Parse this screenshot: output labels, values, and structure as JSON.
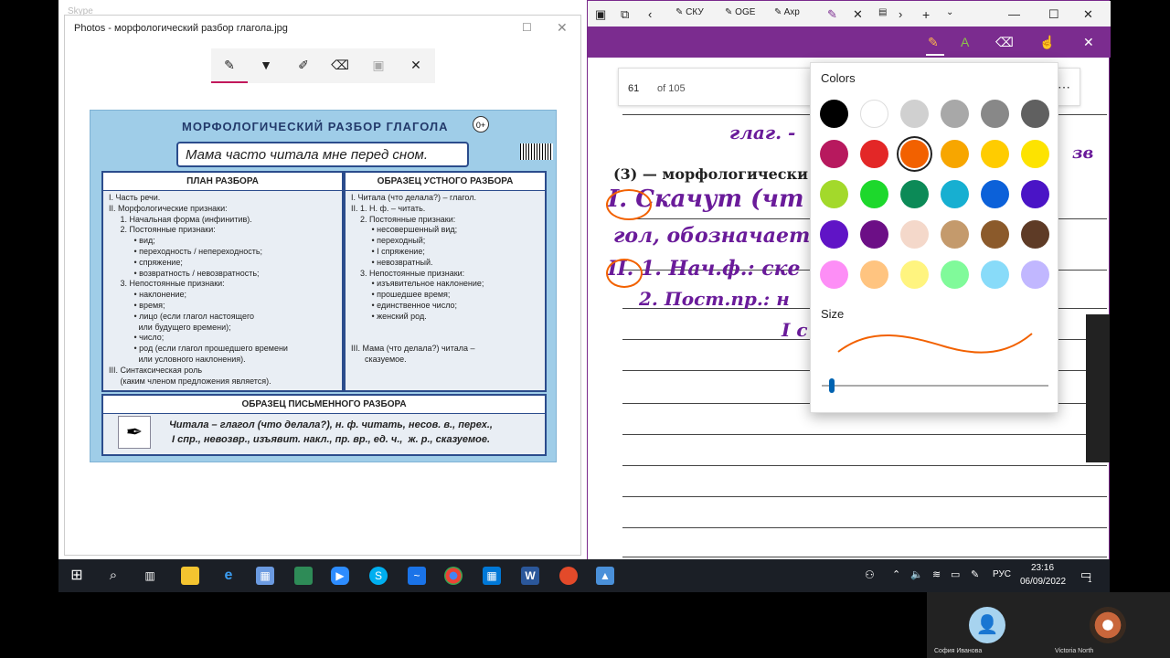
{
  "skype_title": "Skype",
  "photos": {
    "title": "Photos - морфологический разбор глагола.jpg",
    "tools": [
      "ballpoint-pen",
      "calligraphy-pen",
      "pencil",
      "eraser",
      "crop",
      "close"
    ]
  },
  "poster": {
    "heading": "МОРФОЛОГИЧЕСКИЙ РАЗБОР ГЛАГОЛА",
    "age": "0+",
    "sentence": "Мама часто читала мне перед сном.",
    "plan_title": "ПЛАН РАЗБОРА",
    "plan_lines": "I. Часть речи.\nII. Морфологические признаки:\n     1. Начальная форма (инфинитив).\n     2. Постоянные признаки:\n           • вид;\n           • переходность / непереходность;\n           • спряжение;\n           • возвратность / невозвратность;\n     3. Непостоянные признаки:\n           • наклонение;\n           • время;\n           • лицо (если глагол настоящего\n             или будущего времени);\n           • число;\n           • род (если глагол прошедшего времени\n             или условного наклонения).\nIII. Синтаксическая роль\n     (каким членом предложения является).",
    "sample_title": "ОБРАЗЕЦ УСТНОГО РАЗБОРА",
    "sample_lines": "I. Читала (что делала?) – глагол.\nII. 1. Н. ф. – читать.\n    2. Постоянные признаки:\n         • несовершенный вид;\n         • переходный;\n         • I спряжение;\n         • невозвратный.\n    3. Непостоянные признаки:\n         • изъявительное наклонение;\n         • прошедшее время;\n         • единственное число;\n         • женский род.\n\n\nIII. Мама (что делала?) читала –\n      сказуемое.",
    "written_title": "ОБРАЗЕЦ ПИСЬМЕННОГО РАЗБОРА",
    "written_text": "Читала – глагол (что делала?), н. ф. читать, несов. в., перех.,\n I спр., невозвр., изъявит. накл., пр. вр., ед. ч.,  ж. р., сказуемое."
  },
  "onenote": {
    "tabs": [
      "СКУ",
      "OGЕ",
      "Axp"
    ],
    "page_number": "61",
    "page_of": "of 105",
    "typed": "(3) — морфологически",
    "handwriting": [
      "глаг. -",
      "I. Скачут (чт",
      "гол, обозначает",
      "II. 1. Нач.ф.: ске",
      "2. Пост.пр.: н",
      "I с",
      "зв"
    ],
    "colors_title": "Colors",
    "size_title": "Size",
    "swatches": [
      "#000000",
      "#ffffff",
      "#d0d0d0",
      "#a8a8a8",
      "#888888",
      "#606060",
      "#b7195e",
      "#e32727",
      "#f26100",
      "#f7a600",
      "#ffcc00",
      "#fde300",
      "#a3d92b",
      "#1dd82c",
      "#0c8a57",
      "#17afd1",
      "#0c61d9",
      "#4a14c6",
      "#6014c6",
      "#6c0f86",
      "#f4d8ca",
      "#c49a6c",
      "#8b5a2b",
      "#5e3b26",
      "#fd8ef6",
      "#ffc480",
      "#fff47f",
      "#80fa9a",
      "#88dbf9",
      "#c1b7ff"
    ],
    "selected_swatch": 8,
    "stroke_color": "#f26100"
  },
  "taskbar": {
    "lang": "РУС",
    "time": "23:16",
    "date": "06/09/2022",
    "notif_count": "1"
  },
  "participants": [
    "София Иванова",
    "Victoria North"
  ]
}
